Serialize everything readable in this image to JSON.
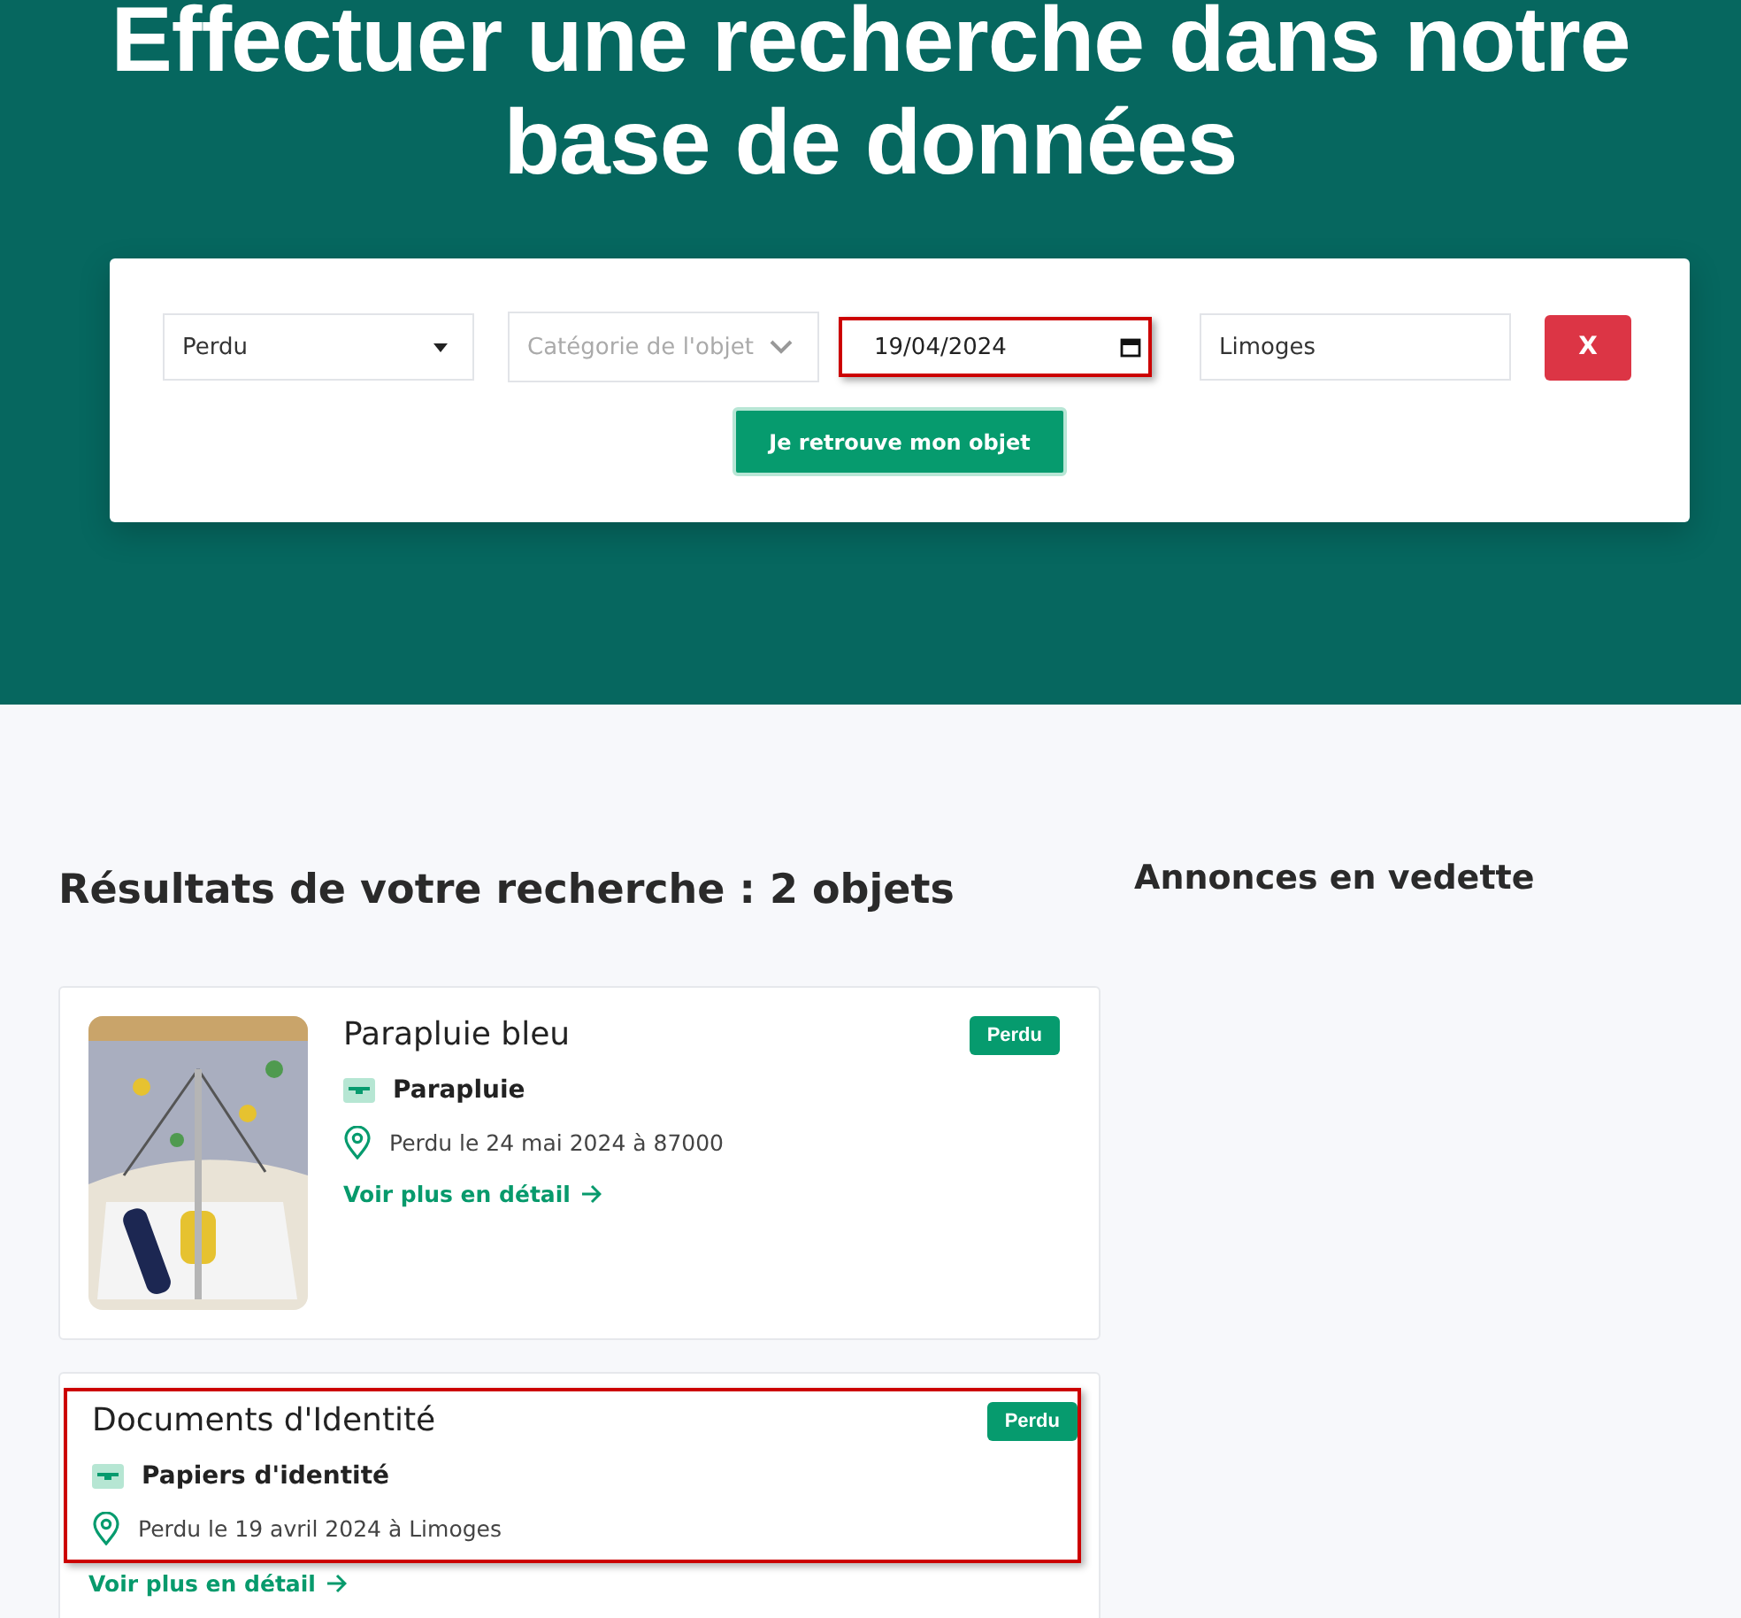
{
  "hero": {
    "title": "Effectuer une recherche dans notre base de données"
  },
  "search_form": {
    "type_select": {
      "value": "Perdu"
    },
    "category_select": {
      "placeholder": "Catégorie de l'objet"
    },
    "date_field": {
      "value": "19/04/2024",
      "highlighted": true
    },
    "city_field": {
      "value": "Limoges"
    },
    "clear_button": "X",
    "submit_button": "Je retrouve mon objet"
  },
  "results": {
    "heading": "Résultats de votre recherche : 2 objets",
    "items": [
      {
        "title": "Parapluie bleu",
        "badge": "Perdu",
        "category": "Parapluie",
        "location": "Perdu le 24 mai 2024 à 87000",
        "link": "Voir plus en détail",
        "highlighted": false
      },
      {
        "title": "Documents d'Identité",
        "badge": "Perdu",
        "category": "Papiers d'identité",
        "location": "Perdu le 19 avril 2024 à Limoges",
        "link": "Voir plus en détail",
        "highlighted": true
      }
    ]
  },
  "sidebar": {
    "heading": "Annonces en vedette"
  }
}
